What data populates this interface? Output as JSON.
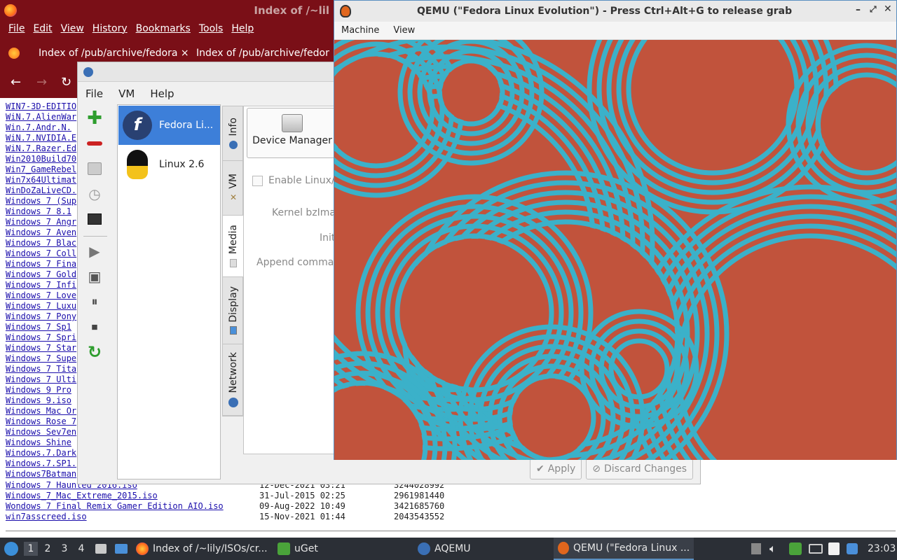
{
  "firefox": {
    "title": "Index of /~lil",
    "menu": [
      "File",
      "Edit",
      "View",
      "History",
      "Bookmarks",
      "Tools",
      "Help"
    ],
    "tabs": [
      "Index of /pub/archive/fedora",
      "Index of /pub/archive/fedora"
    ],
    "tab_close": "×",
    "nav": {
      "back": "←",
      "forward": "→",
      "reload": "↻"
    },
    "files": [
      "WIN7-3D-EDITIO",
      "WiN.7.AlienWar",
      "Win.7.Andr.N.",
      "WiN.7.NVIDIA.E",
      "WiN.7.Razer.Ed",
      "Win2010Build70",
      "Win7_GameRebel",
      "Win7x64Ultimat",
      "WinDoZaLiveCD.",
      "Windows 7 (Sup",
      "Windows 7 8.1",
      "Windows 7 Angr",
      "Windows 7 Aven",
      "Windows 7 Blac",
      "Windows 7 Coll",
      "Windows 7 Fina",
      "Windows 7 Gold",
      "Windows 7 Infi",
      "Windows 7 Love",
      "Windows 7 Luxu",
      "Windows 7 Pony",
      "Windows 7 Sp1",
      "Windows 7 Spri",
      "Windows 7 Star",
      "Windows 7 Supe",
      "Windows 7 Tita",
      "Windows 7 Ulti",
      "Windows 9 Pro",
      "Windows 9.iso",
      "Windows Mac Or",
      "Windows Rose 7",
      "Windows Sev7en",
      "Windows Shine",
      "Windows.7.Dark",
      "Windows.7.SP1.",
      "Windows7Batman"
    ],
    "bottom_rows": [
      {
        "name": "Windows 7 Haunted 2016.iso",
        "date": "12-Dec-2021 03:21",
        "size": "3244028992"
      },
      {
        "name": "Windows_7_Mac_Extreme_2015.iso",
        "date": "31-Jul-2015 02:25",
        "size": "2961981440"
      },
      {
        "name": "Wondows 7 Final Remix Gamer Edition AIO.iso",
        "date": "09-Aug-2022 10:49",
        "size": "3421685760"
      },
      {
        "name": "win7asscreed.iso",
        "date": "15-Nov-2021 01:44",
        "size": "2043543552"
      }
    ]
  },
  "aqemu": {
    "menu": [
      "File",
      "VM",
      "Help"
    ],
    "vms": [
      {
        "name": "Fedora Li...",
        "selected": true
      },
      {
        "name": "Linux 2.6",
        "selected": false
      }
    ],
    "tabs": [
      "Info",
      "VM",
      "Media",
      "Display",
      "Network"
    ],
    "device_manager": "Device Manager",
    "enable_linux": "Enable Linux/I",
    "kernel": "Kernel bzImag",
    "initrd": "Initr",
    "append": "Append comman",
    "apply": "Apply",
    "discard": "Discard Changes"
  },
  "qemu": {
    "title": "QEMU (\"Fedora Linux Evolution\") - Press Ctrl+Alt+G to release grab",
    "menu": [
      "Machine",
      "View"
    ],
    "colors": {
      "bg": "#c1533c",
      "ring": "#3bb1c9"
    }
  },
  "taskbar": {
    "workspaces": [
      "1",
      "2",
      "3",
      "4"
    ],
    "apps": [
      "Index of /~lily/ISOs/cr...",
      "uGet",
      "AQEMU",
      "QEMU (\"Fedora Linux ..."
    ],
    "clock": "23:03"
  }
}
